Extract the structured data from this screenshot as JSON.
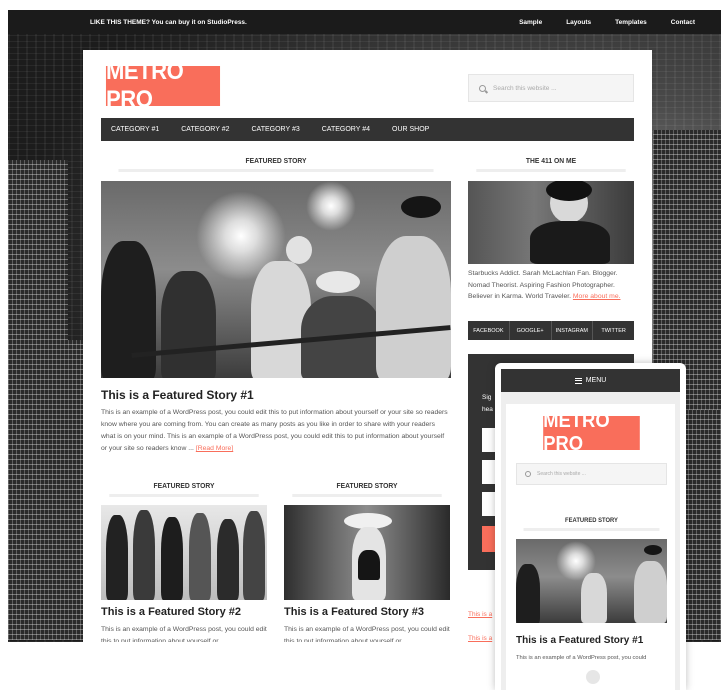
{
  "topbar": {
    "promo": "LIKE THIS THEME? You can buy it on StudioPress.",
    "links": [
      "Sample",
      "Layouts",
      "Templates",
      "Contact"
    ]
  },
  "site": {
    "logo": "METRO PRO",
    "search_placeholder": "Search this website ...",
    "nav": [
      "CATEGORY #1",
      "CATEGORY #2",
      "CATEGORY #3",
      "CATEGORY #4",
      "OUR SHOP"
    ]
  },
  "main": {
    "featured_label": "FEATURED STORY",
    "story1": {
      "title": "This is a Featured Story #1",
      "text": "This is an example of a WordPress post, you could edit this to put information about yourself or your site so readers know where you are coming from. You can create as many posts as you like in order to share with your readers what is on your mind. This is an example of a WordPress post, you could edit this to put information about yourself or your site so readers know ... ",
      "more": "[Read More]"
    },
    "story2": {
      "label": "FEATURED STORY",
      "title": "This is a Featured Story #2",
      "text": "This is an example of a WordPress post, you could edit this to put information about yourself or"
    },
    "story3": {
      "label": "FEATURED STORY",
      "title": "This is a Featured Story #3",
      "text": "This is an example of a WordPress post, you could edit this to put information about yourself or"
    }
  },
  "sidebar": {
    "title": "THE 411 ON ME",
    "bio": "Starbucks Addict. Sarah McLachlan Fan. Blogger. Nomad Theorist. Aspiring Fashion Photographer. Believer in Karma. World Traveler. ",
    "bio_more": "More about me.",
    "social": [
      "FACEBOOK",
      "GOOGLE+",
      "INSTAGRAM",
      "TWITTER"
    ],
    "partial_sign": "Sig",
    "partial_hea": "hea",
    "links": [
      "This is a",
      "This is a"
    ]
  },
  "mobile": {
    "menu": "MENU",
    "logo": "METRO PRO",
    "search_placeholder": "Search this website ...",
    "featured_label": "FEATURED STORY",
    "title": "This is a Featured Story #1",
    "text": "This is an example of a WordPress post, you could"
  },
  "colors": {
    "accent": "#f96e5b",
    "dark": "#333333"
  }
}
